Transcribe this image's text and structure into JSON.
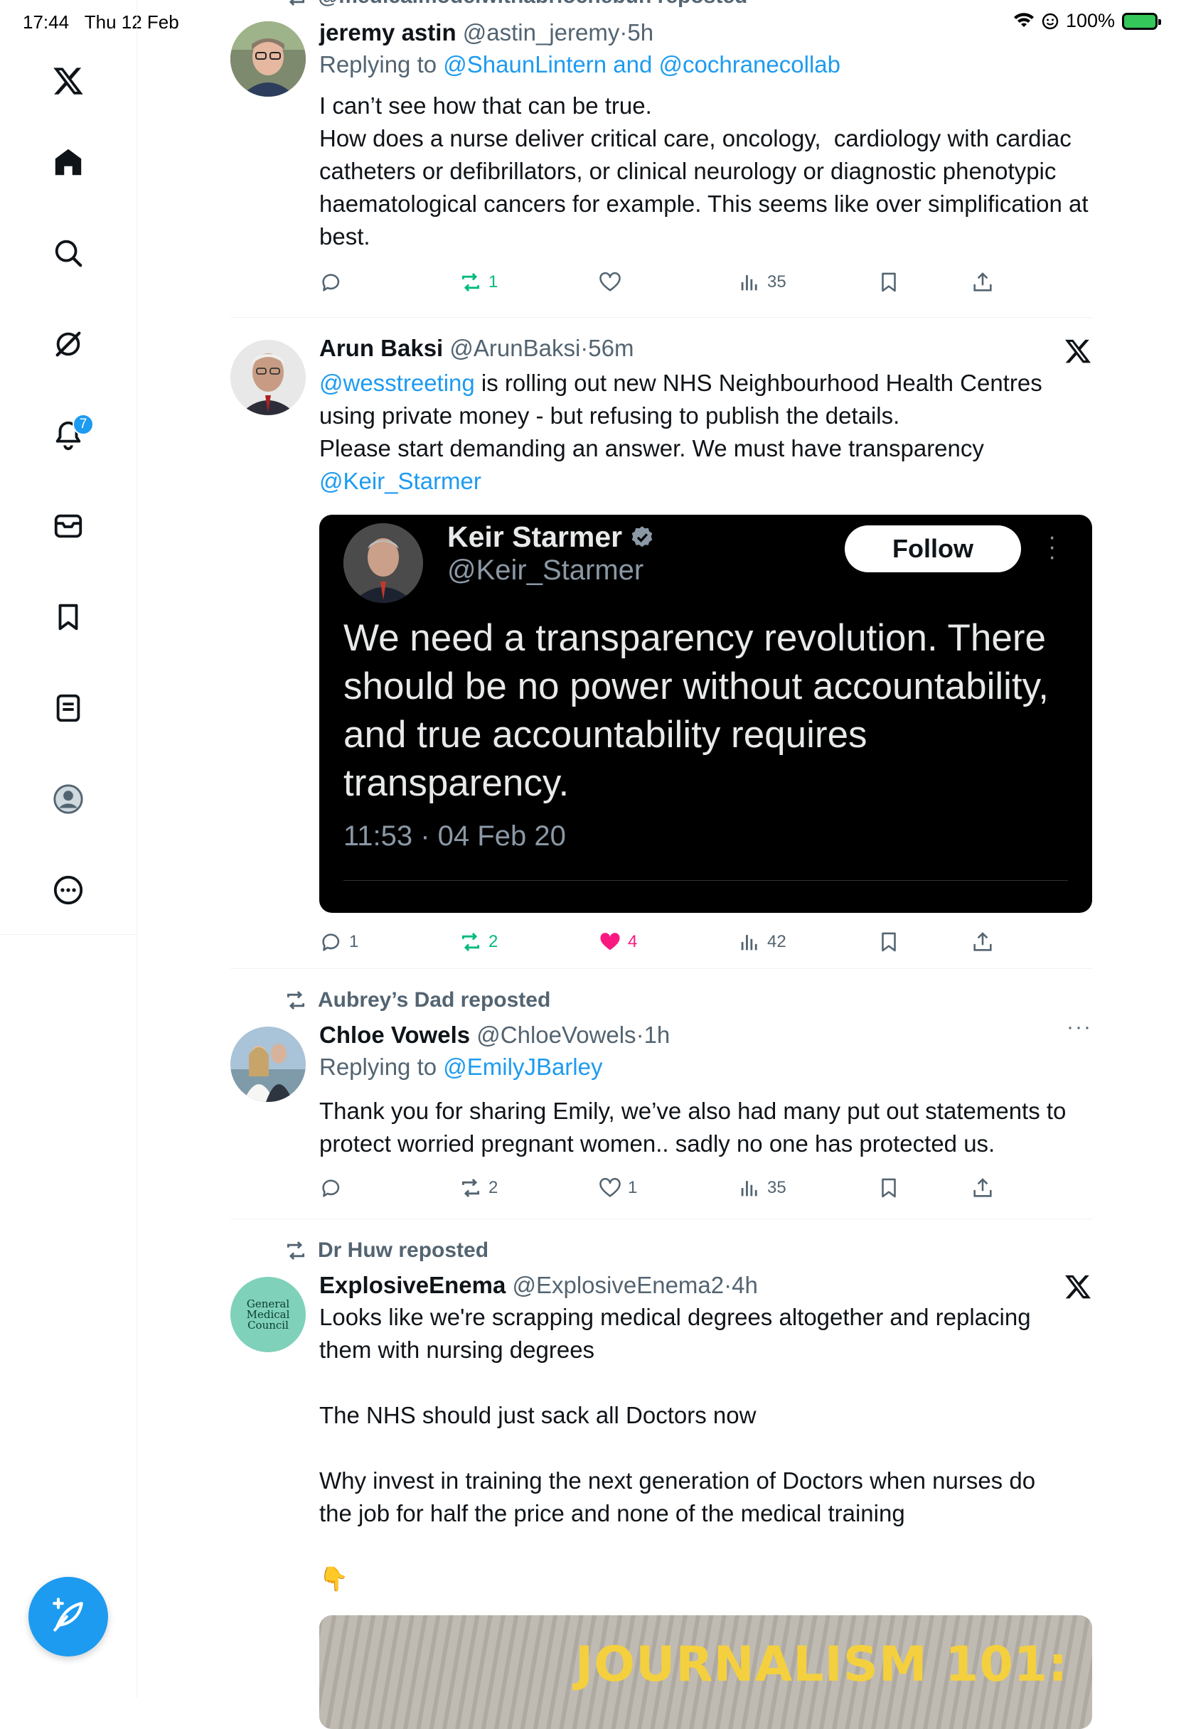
{
  "status": {
    "time": "17:44",
    "date": "Thu 12 Feb",
    "battery": "100%"
  },
  "sidebar": {
    "notifications_badge": "7"
  },
  "top_partial": {
    "text": "@medicalmodelwithabriochebun reposted"
  },
  "tweets": [
    {
      "name": "jeremy astin",
      "handle": "@astin_jeremy",
      "sep": "·",
      "time": "5h",
      "replying_prefix": "Replying to",
      "replying_to": "@ShaunLintern and @cochranecollab",
      "text": "I can’t see how that can be true.\nHow does a nurse deliver critical care, oncology,  cardiology with cardiac catheters or defibrillators, or clinical neurology or diagnostic phenotypic haematological cancers for example. This seems like over simplification at best.",
      "stats": {
        "replies": "",
        "reposts": "1",
        "likes": "",
        "views": "35"
      }
    },
    {
      "name": "Arun Baksi",
      "handle": "@ArunBaksi",
      "sep": "·",
      "time": "56m",
      "text_mention": "@wesstreeting",
      "text_main": " is rolling out new NHS Neighbourhood Health Centres using private money - but refusing to publish the details.\nPlease start demanding an answer. We must have transparency\n",
      "text_mention2": "@Keir_Starmer",
      "embed": {
        "name": "Keir Starmer",
        "handle": "@Keir_Starmer",
        "follow_label": "Follow",
        "text": "We need a transparency revolution. There should be no power without accountability, and true accountability requires transparency.",
        "date": "11:53 · 04 Feb 20"
      },
      "stats": {
        "replies": "1",
        "reposts": "2",
        "likes": "4",
        "views": "42"
      }
    },
    {
      "reposted_by": "Aubrey’s Dad reposted",
      "name": "Chloe Vowels",
      "handle": "@ChloeVowels",
      "sep": "·",
      "time": "1h",
      "replying_prefix": "Replying to",
      "replying_to": "@EmilyJBarley",
      "text": "Thank you for sharing Emily, we’ve also had many put out statements to protect worried pregnant women.. sadly no one has protected us.",
      "stats": {
        "replies": "",
        "reposts": "2",
        "likes": "1",
        "views": "35"
      }
    },
    {
      "reposted_by": "Dr Huw reposted",
      "name": "ExplosiveEnema",
      "handle": "@ExplosiveEnema2",
      "sep": "·",
      "time": "4h",
      "avatar_text": "General Medical Council",
      "text": "Looks like we're scrapping medical degrees altogether and replacing them with nursing degrees\n\nThe NHS should just sack all Doctors now\n\nWhy invest in training the next generation of Doctors when nurses do the job for half the price and none of the medical training\n\n👇",
      "image_overlay_text": "JOURNALISM 101:"
    }
  ]
}
